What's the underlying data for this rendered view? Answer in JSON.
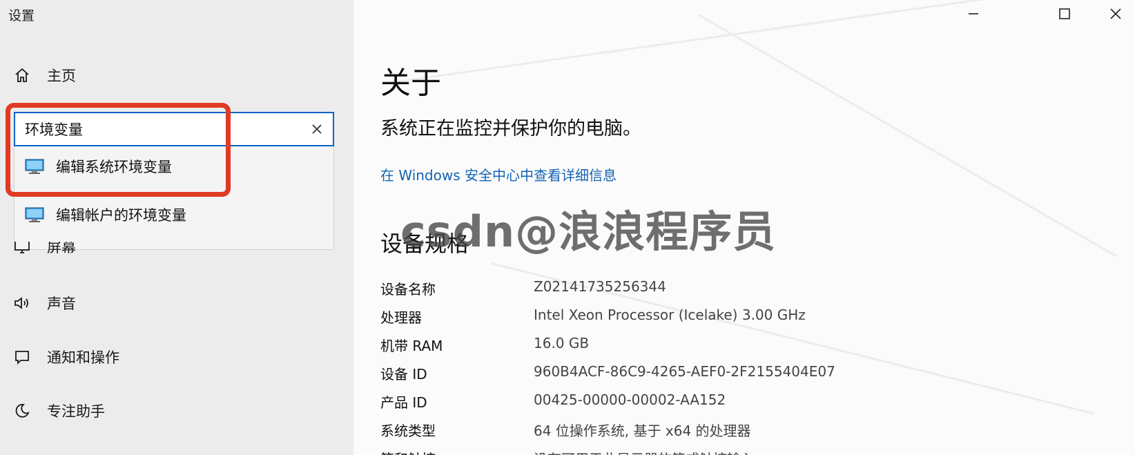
{
  "app": {
    "title": "设置"
  },
  "sidebar": {
    "home_label": "主页",
    "search": {
      "value": "环境变量",
      "placeholder": ""
    },
    "dropdown": [
      {
        "label": "编辑系统环境变量",
        "icon": "computer-icon"
      },
      {
        "label": "编辑帐户的环境变量",
        "icon": "computer-icon"
      }
    ],
    "items": [
      {
        "label": "屏幕",
        "icon": "monitor-icon"
      },
      {
        "label": "声音",
        "icon": "speaker-icon"
      },
      {
        "label": "通知和操作",
        "icon": "notification-icon"
      },
      {
        "label": "专注助手",
        "icon": "moon-icon"
      }
    ]
  },
  "main": {
    "title": "关于",
    "status_text": "系统正在监控并保护你的电脑。",
    "security_link": "在 Windows 安全中心中查看详细信息",
    "specs_title": "设备规格",
    "specs": [
      {
        "key": "设备名称",
        "value": "Z02141735256344"
      },
      {
        "key": "处理器",
        "value": "Intel Xeon Processor (Icelake)   3.00 GHz"
      },
      {
        "key": "机带 RAM",
        "value": "16.0 GB"
      },
      {
        "key": "设备 ID",
        "value": "960B4ACF-86C9-4265-AEF0-2F2155404E07"
      },
      {
        "key": "产品 ID",
        "value": "00425-00000-00002-AA152"
      },
      {
        "key": "系统类型",
        "value": "64 位操作系统, 基于 x64 的处理器"
      },
      {
        "key": "笔和触控",
        "value": "没有可用于此显示器的笔或触控输入"
      }
    ]
  },
  "window_controls": [
    "minimize-icon",
    "maximize-icon",
    "close-icon"
  ],
  "watermark": "csdn@浪浪程序员",
  "colors": {
    "accent": "#0a64c8",
    "highlight": "#e03a24",
    "link": "#1463b4",
    "sidebar_bg": "#ececec"
  }
}
